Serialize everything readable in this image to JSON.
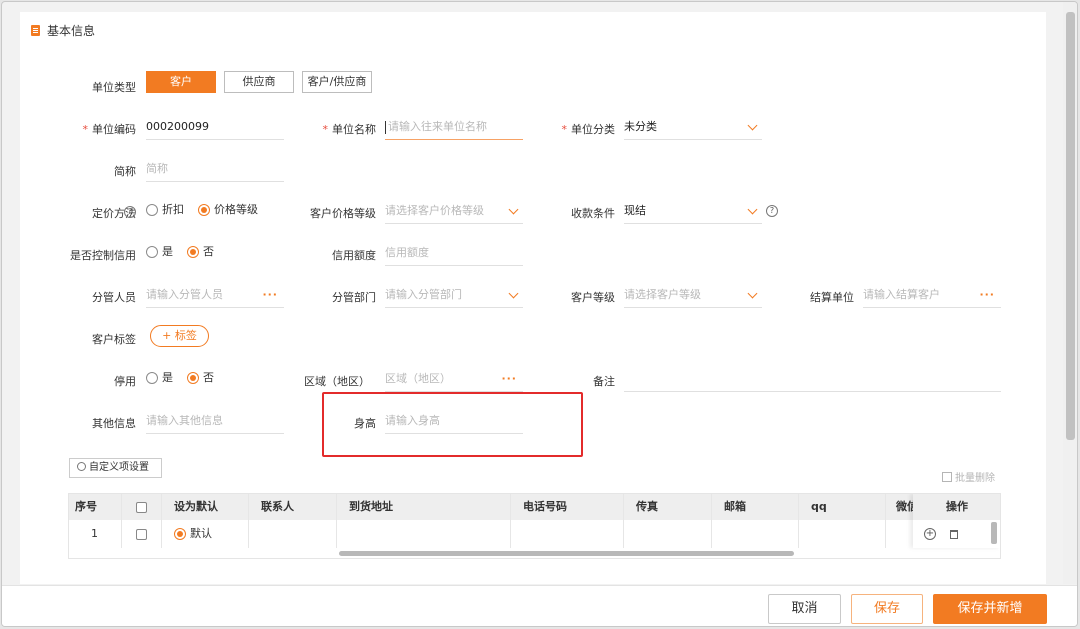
{
  "header": {
    "title": "基本信息"
  },
  "unit_type": {
    "label": "单位类型",
    "options": [
      "客户",
      "供应商",
      "客户/供应商"
    ],
    "selected": "客户"
  },
  "fields": {
    "unit_code": {
      "label": "单位编码",
      "value": "000200099"
    },
    "unit_name": {
      "label": "单位名称",
      "placeholder": "请输入往来单位名称"
    },
    "unit_category": {
      "label": "单位分类",
      "value": "未分类"
    },
    "short_name": {
      "label": "简称",
      "placeholder": "简称"
    },
    "pricing_method": {
      "label": "定价方法",
      "options": [
        "折扣",
        "价格等级"
      ],
      "selected": "价格等级"
    },
    "price_level": {
      "label": "客户价格等级",
      "placeholder": "请选择客户价格等级"
    },
    "payment_terms": {
      "label": "收款条件",
      "value": "现结"
    },
    "credit_control": {
      "label": "是否控制信用",
      "options": [
        "是",
        "否"
      ],
      "selected": "否"
    },
    "credit_limit": {
      "label": "信用额度",
      "placeholder": "信用额度"
    },
    "staff": {
      "label": "分管人员",
      "placeholder": "请输入分管人员"
    },
    "department": {
      "label": "分管部门",
      "placeholder": "请输入分管部门"
    },
    "customer_level": {
      "label": "客户等级",
      "placeholder": "请选择客户等级"
    },
    "settlement_unit": {
      "label": "结算单位",
      "placeholder": "请输入结算客户"
    },
    "customer_tag": {
      "label": "客户标签",
      "button": "+ 标签"
    },
    "disabled": {
      "label": "停用",
      "options": [
        "是",
        "否"
      ],
      "selected": "否"
    },
    "region": {
      "label": "区域（地区）",
      "placeholder": "区域（地区）"
    },
    "remark": {
      "label": "备注"
    },
    "other_info": {
      "label": "其他信息",
      "placeholder": "请输入其他信息"
    },
    "height": {
      "label": "身高",
      "placeholder": "请输入身高"
    }
  },
  "custom_settings_label": "自定义项设置",
  "bulk_delete_label": "批量删除",
  "table": {
    "headers": [
      "序号",
      "",
      "设为默认",
      "联系人",
      "到货地址",
      "电话号码",
      "传真",
      "邮箱",
      "qq",
      "微信",
      "操作"
    ],
    "rows": [
      {
        "index": "1",
        "default_label": "默认"
      }
    ]
  },
  "footer": {
    "cancel": "取消",
    "save": "保存",
    "save_and_new": "保存并新增"
  },
  "colors": {
    "accent": "#f27b22",
    "highlight_box": "#e32b2b"
  }
}
